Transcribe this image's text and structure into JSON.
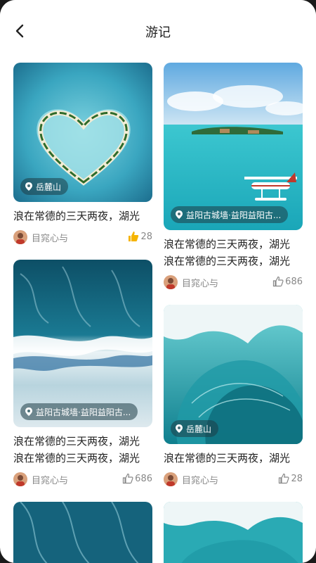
{
  "header": {
    "title": "游记",
    "back_icon": "chevron-left-icon"
  },
  "cards": [
    {
      "location": "岳麓山",
      "title_lines": [
        "浪在常德的三天两夜，湖光"
      ],
      "user": "目窕心与",
      "likes": "28",
      "liked": true
    },
    {
      "location": "益阳古城墙·益阳益阳古...",
      "title_lines": [
        "浪在常德的三天两夜，湖光",
        "浪在常德的三天两夜，湖光"
      ],
      "user": "目窕心与",
      "likes": "686",
      "liked": false
    },
    {
      "location": "益阳古城墙·益阳益阳古...",
      "title_lines": [
        "浪在常德的三天两夜，湖光",
        "浪在常德的三天两夜，湖光"
      ],
      "user": "目窕心与",
      "likes": "686",
      "liked": false
    },
    {
      "location": "岳麓山",
      "title_lines": [
        "浪在常德的三天两夜，湖光"
      ],
      "user": "目窕心与",
      "likes": "28",
      "liked": false
    }
  ],
  "colors": {
    "like_active": "#f5b400",
    "text": "#222222",
    "muted": "#888888"
  }
}
